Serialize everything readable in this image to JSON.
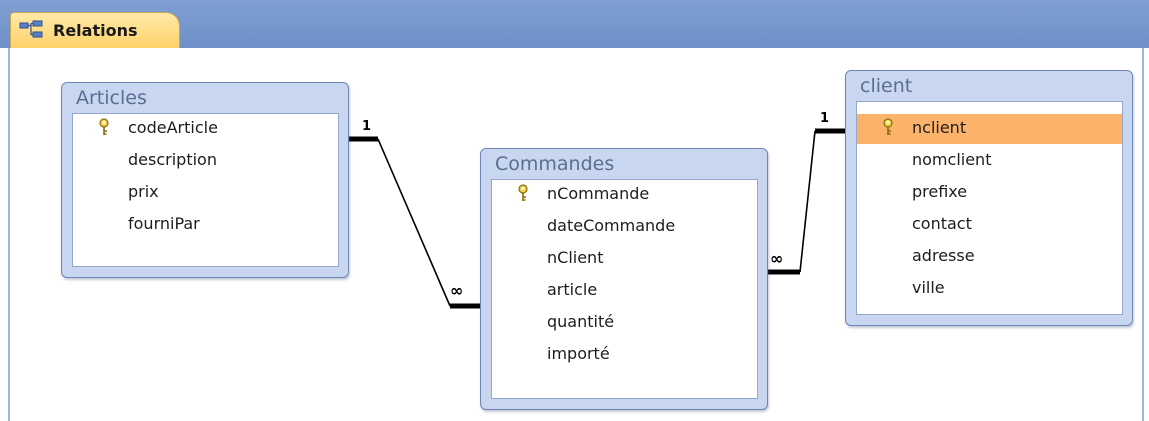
{
  "tab": {
    "label": "Relations"
  },
  "tables": {
    "articles": {
      "title": "Articles",
      "fields": [
        {
          "label": "codeArticle",
          "key": true
        },
        {
          "label": "description",
          "key": false
        },
        {
          "label": "prix",
          "key": false
        },
        {
          "label": "fourniPar",
          "key": false
        }
      ]
    },
    "commandes": {
      "title": "Commandes",
      "fields": [
        {
          "label": "nCommande",
          "key": true
        },
        {
          "label": "dateCommande",
          "key": false
        },
        {
          "label": "nClient",
          "key": false
        },
        {
          "label": "article",
          "key": false
        },
        {
          "label": "quantité",
          "key": false
        },
        {
          "label": "importé",
          "key": false
        }
      ]
    },
    "client": {
      "title": "client",
      "fields": [
        {
          "label": "nclient",
          "key": true,
          "selected": true
        },
        {
          "label": "nomclient",
          "key": false
        },
        {
          "label": "prefixe",
          "key": false
        },
        {
          "label": "contact",
          "key": false
        },
        {
          "label": "adresse",
          "key": false
        },
        {
          "label": "ville",
          "key": false
        }
      ]
    }
  },
  "relationships": [
    {
      "from": "Articles.codeArticle",
      "to": "Commandes.article",
      "one_label": "1",
      "many_label": "∞"
    },
    {
      "from": "client.nclient",
      "to": "Commandes.nClient",
      "one_label": "1",
      "many_label": "∞"
    }
  ],
  "colors": {
    "selected_row": "#fbb36c",
    "tab": "#ffd26a",
    "tabstrip": "#7f9fd2",
    "table_frame": "#c8d7ef"
  }
}
